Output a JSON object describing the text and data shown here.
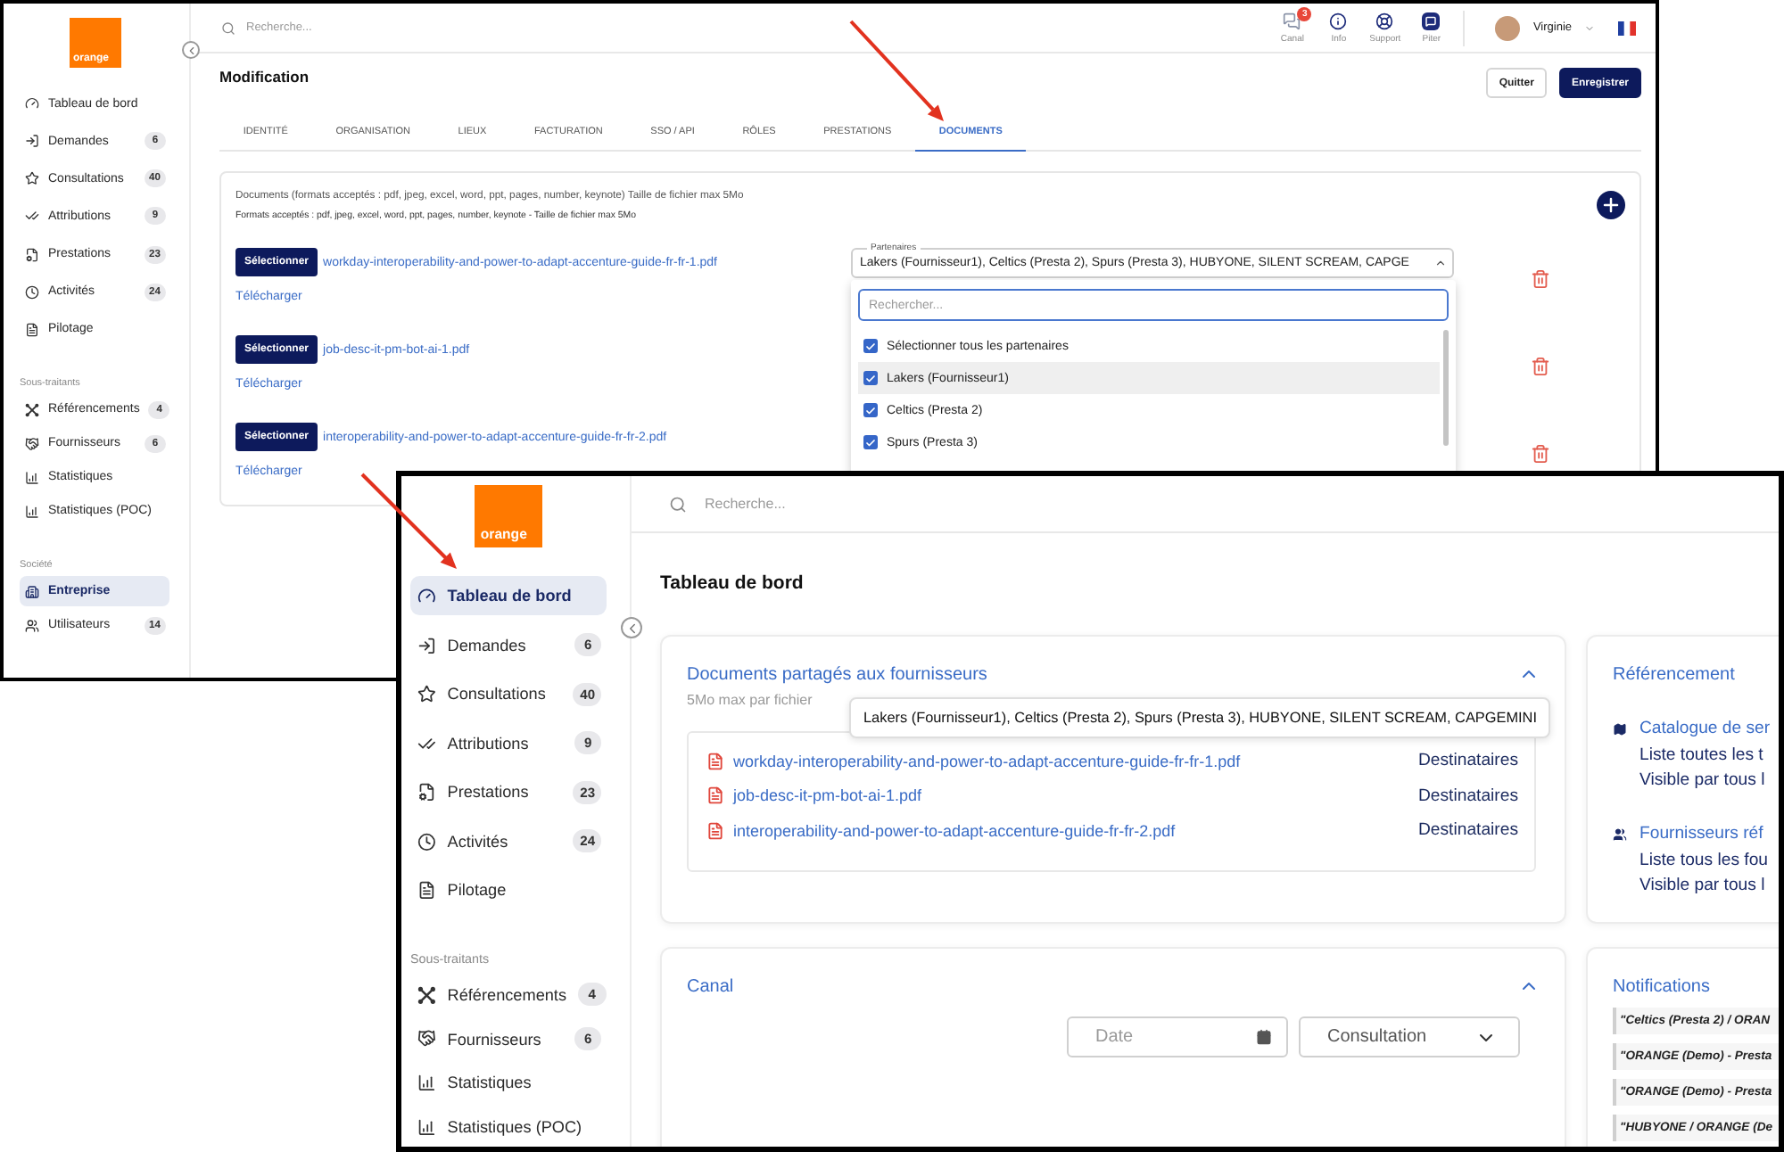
{
  "edit_window": {
    "logo": "orange",
    "sidebar": {
      "sections": [
        {
          "items": [
            {
              "label": "Tableau de bord",
              "selected": false
            },
            {
              "label": "Demandes",
              "count": "6",
              "selected": false
            },
            {
              "label": "Consultations",
              "count": "40",
              "selected": false
            },
            {
              "label": "Attributions",
              "count": "9",
              "selected": false
            },
            {
              "label": "Prestations",
              "count": "23",
              "selected": false
            },
            {
              "label": "Activités",
              "count": "24",
              "selected": false
            },
            {
              "label": "Pilotage",
              "selected": false
            }
          ]
        },
        {
          "title": "Sous-traitants",
          "items": [
            {
              "label": "Référencements",
              "count": "4",
              "selected": false
            },
            {
              "label": "Fournisseurs",
              "count": "6",
              "selected": false
            },
            {
              "label": "Statistiques",
              "selected": false
            },
            {
              "label": "Statistiques (POC)",
              "selected": false
            }
          ]
        },
        {
          "title": "Société",
          "items": [
            {
              "label": "Entreprise",
              "selected": true
            },
            {
              "label": "Utilisateurs",
              "count": "14",
              "selected": false
            }
          ]
        }
      ]
    },
    "search": {
      "placeholder": "Recherche..."
    },
    "toolbar": [
      {
        "label": "Canal",
        "badge": "3"
      },
      {
        "label": "Info"
      },
      {
        "label": "Support"
      },
      {
        "label": "Piter"
      }
    ],
    "user": {
      "name": "Virginie"
    },
    "page_title": "Modification",
    "actions": [
      {
        "label": "Quitter",
        "kind": "secondary"
      },
      {
        "label": "Enregistrer",
        "kind": "primary"
      }
    ],
    "tabs": [
      {
        "label": "IDENTITÉ",
        "selected": false
      },
      {
        "label": "ORGANISATION",
        "selected": false
      },
      {
        "label": "LIEUX",
        "selected": false
      },
      {
        "label": "FACTURATION",
        "selected": false
      },
      {
        "label": "SSO / API",
        "selected": false
      },
      {
        "label": "RÔLES",
        "selected": false
      },
      {
        "label": "PRESTATIONS",
        "selected": false
      },
      {
        "label": "DOCUMENTS",
        "selected": true
      }
    ],
    "documents": {
      "heading": "Documents (formats acceptés : pdf, jpeg, excel, word, ppt, pages, number, keynote) Taille de fichier max 5Mo",
      "note": "Formats acceptés : pdf, jpeg, excel, word, ppt, pages, number, keynote - Taille de fichier max 5Mo",
      "rows": [
        {
          "button": "Sélectionner",
          "file": "workday-interoperability-and-power-to-adapt-accenture-guide-fr-fr-1.pdf",
          "download": "Télécharger"
        },
        {
          "button": "Sélectionner",
          "file": "job-desc-it-pm-bot-ai-1.pdf",
          "download": "Télécharger"
        },
        {
          "button": "Sélectionner",
          "file": "interoperability-and-power-to-adapt-accenture-guide-fr-fr-2.pdf",
          "download": "Télécharger"
        }
      ]
    },
    "partners_field": {
      "label": "Partenaires",
      "value": "Lakers (Fournisseur1), Celtics (Presta 2), Spurs (Presta 3), HUBYONE, SILENT SCREAM, CAPGE"
    },
    "partners_menu": {
      "placeholder": "Rechercher...",
      "options": [
        {
          "label": "Sélectionner tous les partenaires",
          "checked": true,
          "highlighted": false
        },
        {
          "label": "Lakers (Fournisseur1)",
          "checked": true,
          "highlighted": true
        },
        {
          "label": "Celtics (Presta 2)",
          "checked": true,
          "highlighted": false
        },
        {
          "label": "Spurs (Presta 3)",
          "checked": true,
          "highlighted": false
        }
      ]
    }
  },
  "dashboard_window": {
    "logo": "orange",
    "sidebar": {
      "sections": [
        {
          "items": [
            {
              "label": "Tableau de bord",
              "selected": true
            },
            {
              "label": "Demandes",
              "count": "6",
              "selected": false
            },
            {
              "label": "Consultations",
              "count": "40",
              "selected": false
            },
            {
              "label": "Attributions",
              "count": "9",
              "selected": false
            },
            {
              "label": "Prestations",
              "count": "23",
              "selected": false
            },
            {
              "label": "Activités",
              "count": "24",
              "selected": false
            },
            {
              "label": "Pilotage",
              "selected": false
            }
          ]
        },
        {
          "title": "Sous-traitants",
          "items": [
            {
              "label": "Référencements",
              "count": "4",
              "selected": false
            },
            {
              "label": "Fournisseurs",
              "count": "6",
              "selected": false
            },
            {
              "label": "Statistiques",
              "selected": false
            },
            {
              "label": "Statistiques (POC)",
              "selected": false
            }
          ]
        }
      ]
    },
    "search": {
      "placeholder": "Recherche..."
    },
    "page_title": "Tableau de bord",
    "documents_card": {
      "title": "Documents partagés aux fournisseurs",
      "expanded": true,
      "subtitle": "5Mo max par fichier",
      "files": [
        {
          "name": "workday-interoperability-and-power-to-adapt-accenture-guide-fr-fr-1.pdf",
          "action": "Destinataires"
        },
        {
          "name": "job-desc-it-pm-bot-ai-1.pdf",
          "action": "Destinataires"
        },
        {
          "name": "interoperability-and-power-to-adapt-accenture-guide-fr-fr-2.pdf",
          "action": "Destinataires"
        }
      ]
    },
    "recipients_tooltip": "Lakers (Fournisseur1), Celtics (Presta 2), Spurs (Presta 3), HUBYONE, SILENT SCREAM, CAPGEMINI",
    "referencement_card": {
      "title": "Référencement",
      "entries": [
        {
          "title": "Catalogue de ser",
          "lines": [
            "Liste toutes les t",
            "Visible par tous l"
          ]
        },
        {
          "title": "Fournisseurs réf",
          "lines": [
            "Liste tous les fou",
            "Visible par tous l"
          ]
        }
      ]
    },
    "canal_card": {
      "title": "Canal",
      "expanded": true,
      "date_field": {
        "placeholder": "Date"
      },
      "type_select": {
        "value": "Consultation"
      }
    },
    "notifications_card": {
      "title": "Notifications",
      "items": [
        "\"Celtics (Presta 2) / ORAN",
        "\"ORANGE (Demo) - Presta",
        "\"ORANGE (Demo) - Presta",
        "\"HUBYONE / ORANGE (De"
      ]
    }
  }
}
